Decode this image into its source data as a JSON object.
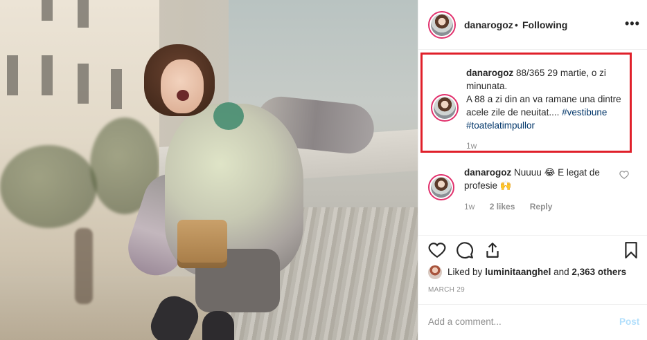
{
  "header": {
    "username": "danarogoz",
    "separator": "•",
    "follow_status": "Following",
    "more_icon": "more-horizontal-icon",
    "more_label": "•••"
  },
  "caption": {
    "username": "danarogoz",
    "text_line1": "88/365 29 martie, o zi minunata.",
    "text_line2": "A 88 a zi din an va ramane una dintre acele zile de neuitat....",
    "hashtags": [
      "#vestibune",
      "#toatelatimpullor"
    ],
    "time": "1w",
    "highlight_color": "#e0202a"
  },
  "comments": [
    {
      "username": "danarogoz",
      "text": "Nuuuu 😂 E legat de profesie 🙌",
      "time": "1w",
      "likes": "2 likes",
      "reply_label": "Reply"
    }
  ],
  "actions": {
    "like_icon": "heart-icon",
    "comment_icon": "comment-icon",
    "share_icon": "share-icon",
    "save_icon": "bookmark-icon"
  },
  "likes": {
    "prefix": "Liked by",
    "user": "luminitaanghel",
    "suffix": "and",
    "others": "2,363 others"
  },
  "date": "MARCH 29",
  "composer": {
    "placeholder": "Add a comment...",
    "post_label": "Post"
  }
}
